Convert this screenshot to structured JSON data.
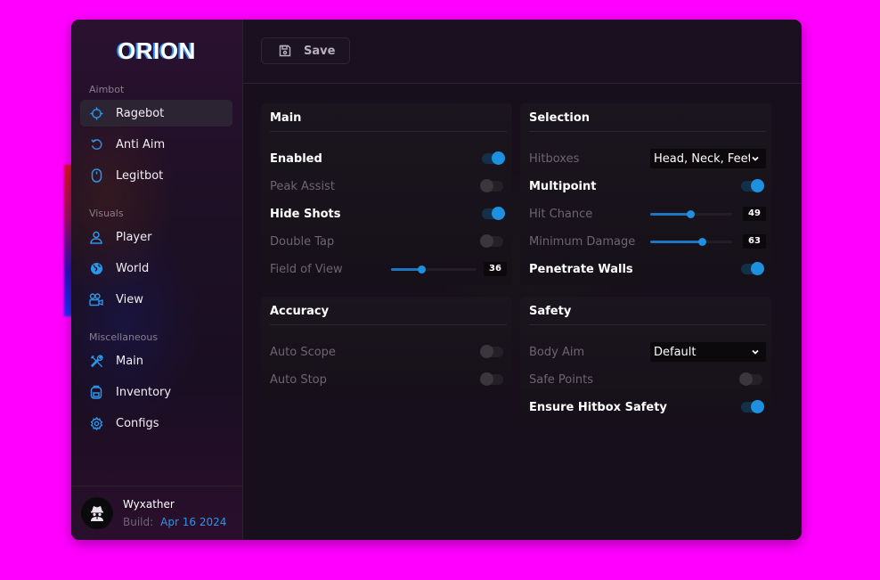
{
  "app": {
    "logo": "ORION"
  },
  "sidebar": {
    "sections": [
      {
        "label": "Aimbot"
      },
      {
        "label": "Visuals"
      },
      {
        "label": "Miscellaneous"
      }
    ],
    "items": [
      {
        "label": "Ragebot",
        "icon": "crosshair-icon"
      },
      {
        "label": "Anti Aim",
        "icon": "rotate-ccw-icon"
      },
      {
        "label": "Legitbot",
        "icon": "mouse-icon"
      },
      {
        "label": "Player",
        "icon": "user-icon"
      },
      {
        "label": "World",
        "icon": "globe-icon"
      },
      {
        "label": "View",
        "icon": "camera-icon"
      },
      {
        "label": "Main",
        "icon": "tools-icon"
      },
      {
        "label": "Inventory",
        "icon": "backpack-icon"
      },
      {
        "label": "Configs",
        "icon": "gear-icon"
      }
    ],
    "user": {
      "name": "Wyxather",
      "build_label": "Build:",
      "build_value": "Apr 16 2024"
    }
  },
  "toolbar": {
    "save_label": "Save"
  },
  "panels": {
    "main": {
      "title": "Main",
      "rows": [
        {
          "label": "Enabled",
          "enabled": true
        },
        {
          "label": "Peak Assist",
          "enabled": false
        },
        {
          "label": "Hide Shots",
          "enabled": true
        },
        {
          "label": "Double Tap",
          "enabled": false
        },
        {
          "label": "Field of View",
          "value": "36",
          "fraction": 0.35
        }
      ]
    },
    "selection": {
      "title": "Selection",
      "rows": [
        {
          "label": "Hitboxes",
          "value": "Head, Neck, Feet"
        },
        {
          "label": "Multipoint",
          "enabled": true
        },
        {
          "label": "Hit Chance",
          "value": "49",
          "fraction": 0.49
        },
        {
          "label": "Minimum Damage",
          "value": "63",
          "fraction": 0.63
        },
        {
          "label": "Penetrate Walls",
          "enabled": true
        }
      ]
    },
    "accuracy": {
      "title": "Accuracy",
      "rows": [
        {
          "label": "Auto Scope",
          "enabled": false
        },
        {
          "label": "Auto Stop",
          "enabled": false
        }
      ]
    },
    "safety": {
      "title": "Safety",
      "rows": [
        {
          "label": "Body Aim",
          "value": "Default"
        },
        {
          "label": "Safe Points",
          "enabled": false
        },
        {
          "label": "Ensure Hitbox Safety",
          "enabled": true
        }
      ]
    }
  },
  "colors": {
    "accent": "#1e90e0",
    "background": "#ff00ff",
    "window": "#15101a"
  }
}
